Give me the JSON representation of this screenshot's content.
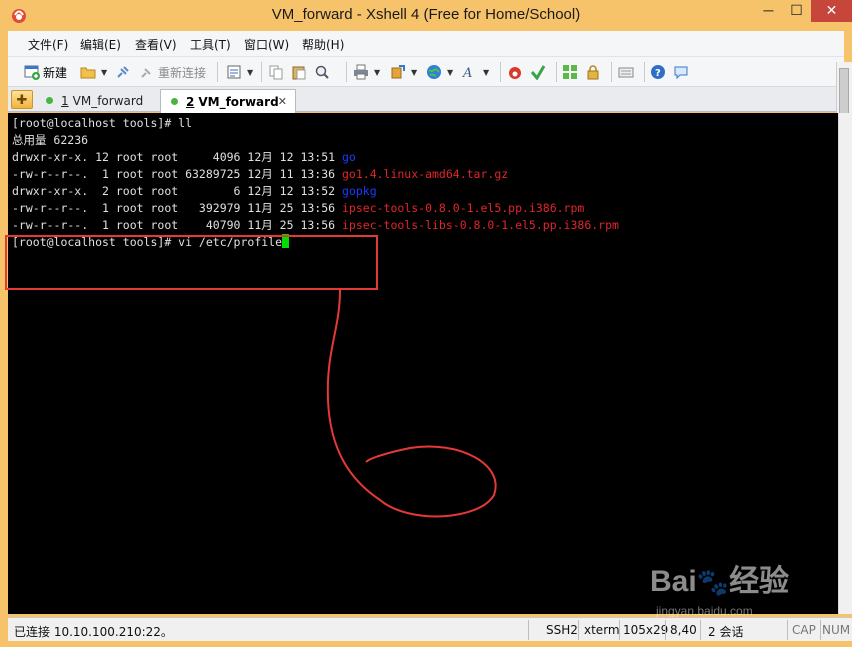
{
  "window": {
    "title": "VM_forward - Xshell 4 (Free for Home/School)",
    "minimize": "─",
    "maximize": "☐",
    "close": "✕"
  },
  "menu": [
    "文件(F)",
    "编辑(E)",
    "查看(V)",
    "工具(T)",
    "窗口(W)",
    "帮助(H)"
  ],
  "toolbar": {
    "new_label": "新建",
    "reconnect_label": "重新连接"
  },
  "tabs": [
    {
      "number": "1",
      "label": "VM_forward"
    },
    {
      "number": "2",
      "label": "VM_forward",
      "close": "✕"
    }
  ],
  "terminal": {
    "lines": [
      {
        "text": "[root@localhost tools]# ll"
      },
      {
        "text": "总用量 62236"
      },
      {
        "text": "drwxr-xr-x. 12 root root     4096 12月 12 13:51 ",
        "name": "go",
        "color": "blue"
      },
      {
        "text": "-rw-r--r--.  1 root root 63289725 12月 11 13:36 ",
        "name": "go1.4.linux-amd64.tar.gz",
        "color": "red"
      },
      {
        "text": "drwxr-xr-x.  2 root root        6 12月 12 13:52 ",
        "name": "gopkg",
        "color": "blue"
      },
      {
        "text": "-rw-r--r--.  1 root root   392979 11月 25 13:56 ",
        "name": "ipsec-tools-0.8.0-1.el5.pp.i386.rpm",
        "color": "red"
      },
      {
        "text": "-rw-r--r--.  1 root root    40790 11月 25 13:56 ",
        "name": "ipsec-tools-libs-0.8.0-1.el5.pp.i386.rpm",
        "color": "red"
      },
      {
        "text": "[root@localhost tools]# vi /etc/profile"
      }
    ],
    "colors": {
      "blue": "#1a3cff",
      "red": "#e0262a",
      "cursor": "#00e000"
    }
  },
  "watermark": {
    "brand": "Bai",
    "paw": "du",
    "suffix": "经验",
    "url": "jingyan.baidu.com"
  },
  "statusbar": {
    "connection": "已连接 10.10.100.210:22。",
    "protocol": "SSH2",
    "term": "xterm",
    "size": "105x29",
    "cursor_pos": "8,40",
    "sessions": "2 会话",
    "cap": "CAP",
    "num": "NUM"
  },
  "accent": "#f6c36a",
  "annotation_color": "#e53935"
}
